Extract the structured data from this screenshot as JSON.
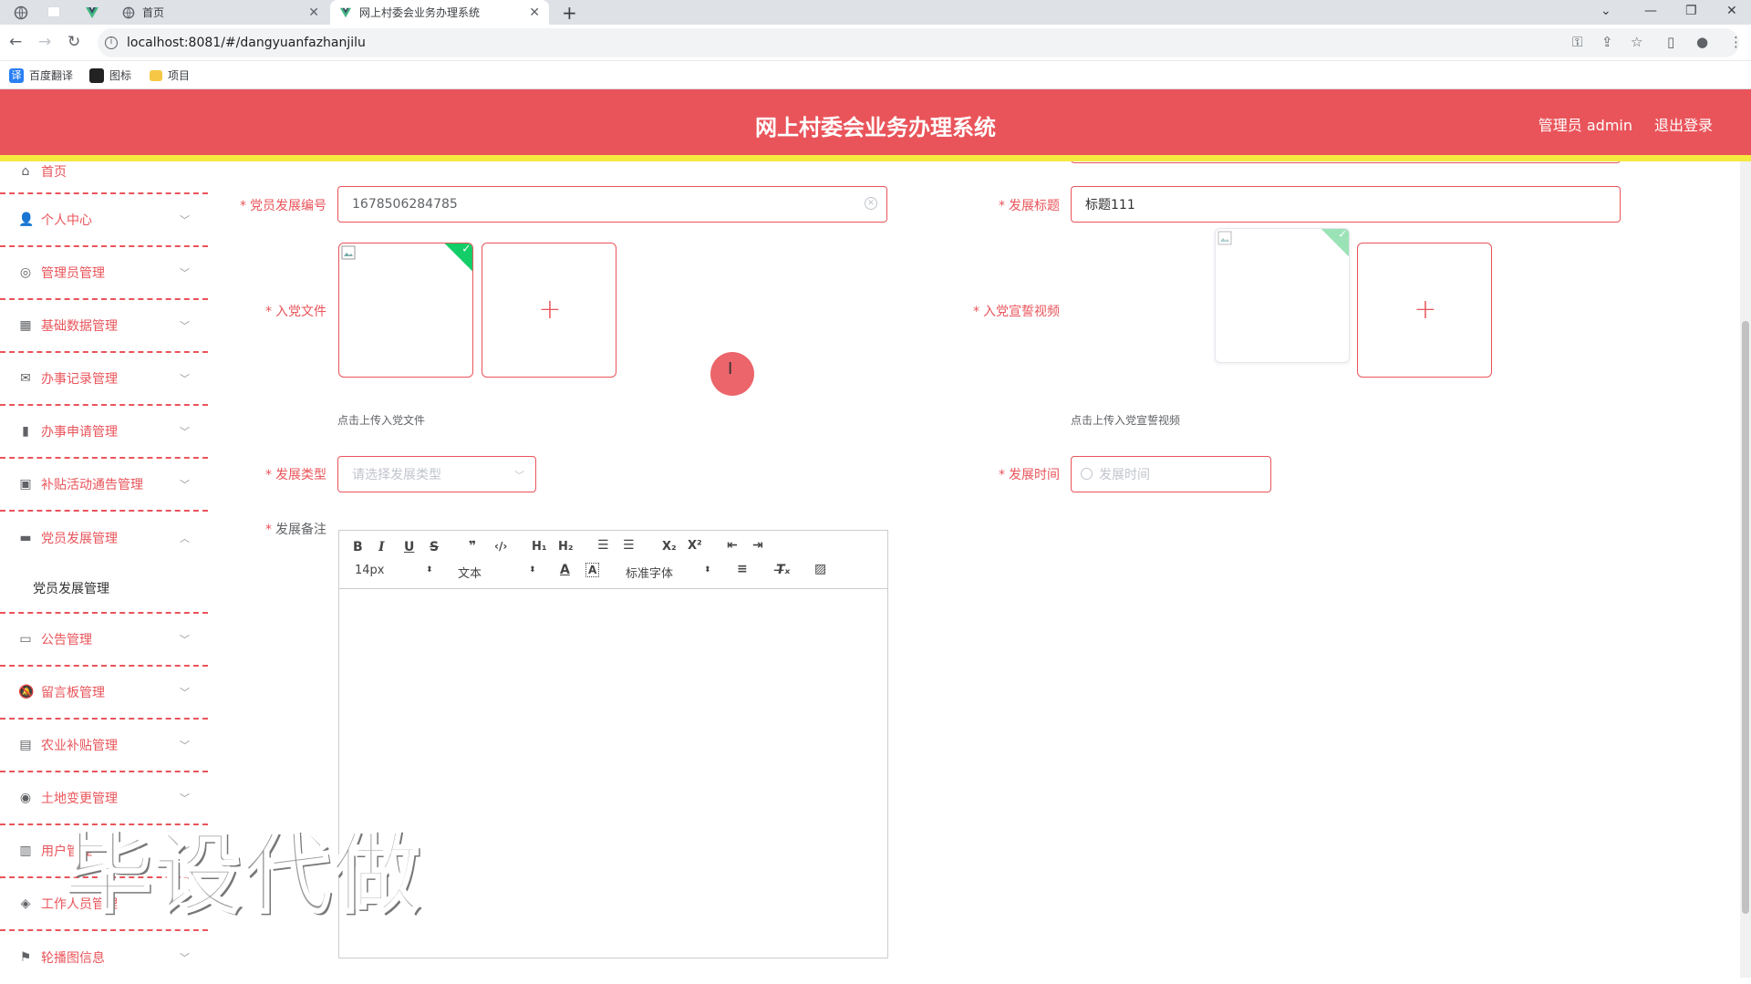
{
  "browser": {
    "tabs": [
      {
        "label": "首页"
      },
      {
        "label": "网上村委会业务办理系统"
      }
    ],
    "url": "localhost:8081/#/dangyuanfazhanjilu",
    "bookmarks": [
      {
        "label": "百度翻译"
      },
      {
        "label": "图标"
      },
      {
        "label": "项目"
      }
    ]
  },
  "header": {
    "title": "网上村委会业务办理系统",
    "user": "管理员 admin",
    "logout": "退出登录"
  },
  "sidebar": {
    "items": [
      {
        "label": "首页",
        "icon": "home-icon"
      },
      {
        "label": "个人中心",
        "icon": "user-icon"
      },
      {
        "label": "管理员管理",
        "icon": "admin-icon"
      },
      {
        "label": "基础数据管理",
        "icon": "grid-icon"
      },
      {
        "label": "办事记录管理",
        "icon": "mail-icon"
      },
      {
        "label": "办事申请管理",
        "icon": "mic-icon"
      },
      {
        "label": "补贴活动通告管理",
        "icon": "clipboard-icon"
      },
      {
        "label": "党员发展管理",
        "icon": "monitor-icon"
      },
      {
        "label": "公告管理",
        "icon": "chat-icon"
      },
      {
        "label": "留言板管理",
        "icon": "bell-icon"
      },
      {
        "label": "农业补贴管理",
        "icon": "doc-icon"
      },
      {
        "label": "土地变更管理",
        "icon": "target-icon"
      },
      {
        "label": "用户管理",
        "icon": "doc2-icon"
      },
      {
        "label": "工作人员管理",
        "icon": "ticket-icon"
      },
      {
        "label": "轮播图信息",
        "icon": "flag-icon"
      }
    ],
    "submenu_label": "党员发展管理"
  },
  "form": {
    "code_label": "党员发展编号",
    "code_value": "1678506284785",
    "title_label": "发展标题",
    "title_value": "标题111",
    "file_label": "入党文件",
    "file_hint": "点击上传入党文件",
    "video_label": "入党宣誓视频",
    "video_hint": "点击上传入党宣誓视频",
    "type_label": "发展类型",
    "type_placeholder": "请选择发展类型",
    "time_label": "发展时间",
    "time_placeholder": "发展时间",
    "remark_label": "发展备注",
    "required_mark": "*"
  },
  "editor": {
    "font_size": "14px",
    "format": "文本",
    "font": "标准字体"
  },
  "watermark": "毕设代做",
  "colors": {
    "primary": "#e9545a",
    "accent_bar": "#f5e83f",
    "success": "#13ce66"
  }
}
